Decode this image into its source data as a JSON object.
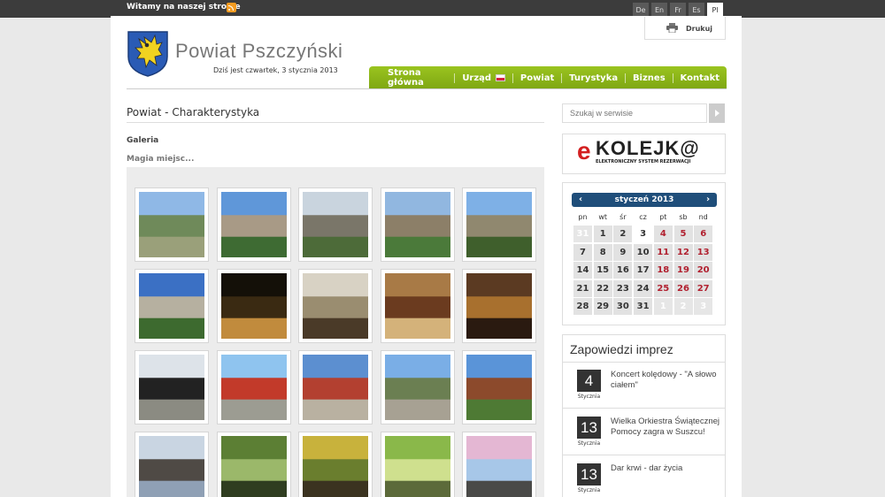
{
  "topbar": {
    "welcome": "Witamy na naszej stronie",
    "rss_icon": "rss-icon",
    "languages": [
      "De",
      "En",
      "Fr",
      "Es",
      "Pl"
    ],
    "active_language": "Pl"
  },
  "header": {
    "print_label": "Drukuj",
    "site_title": "Powiat Pszczyński",
    "date_text": "Dziś jest czwartek, 3 stycznia 2013",
    "nav": [
      "Strona główna",
      "Urząd",
      "Powiat",
      "Turystyka",
      "Biznes",
      "Kontakt"
    ]
  },
  "main": {
    "heading": "Powiat - Charakterystyka",
    "breadcrumb": "Galeria",
    "subcrumb": "Magia miejsc...",
    "gallery_count": 20
  },
  "sidebar": {
    "search_placeholder": "Szukaj w serwisie",
    "ekolej": {
      "e": "e",
      "rest": "KOLEJK@",
      "sub": "ELEKTRONICZNY SYSTEM REZERWACJI"
    },
    "calendar": {
      "month": "styczeń 2013",
      "prev": "‹",
      "next": "›",
      "dow": [
        "pn",
        "wt",
        "śr",
        "cz",
        "pt",
        "sb",
        "nd"
      ],
      "weeks": [
        [
          "31",
          "1",
          "2",
          "3",
          "4",
          "5",
          "6"
        ],
        [
          "7",
          "8",
          "9",
          "10",
          "11",
          "12",
          "13"
        ],
        [
          "14",
          "15",
          "16",
          "17",
          "18",
          "19",
          "20"
        ],
        [
          "21",
          "22",
          "23",
          "24",
          "25",
          "26",
          "27"
        ],
        [
          "28",
          "29",
          "30",
          "31",
          "1",
          "2",
          "3"
        ]
      ]
    },
    "events_title": "Zapowiedzi imprez",
    "events": [
      {
        "day": "4",
        "month": "Stycznia",
        "title": "Koncert kolędowy - \"A słowo ciałem\""
      },
      {
        "day": "13",
        "month": "Stycznia",
        "title": "Wielka Orkiestra Świątecznej Pomocy zagra w Suszcu!"
      },
      {
        "day": "13",
        "month": "Stycznia",
        "title": "Dar krwi - dar życia"
      }
    ]
  }
}
